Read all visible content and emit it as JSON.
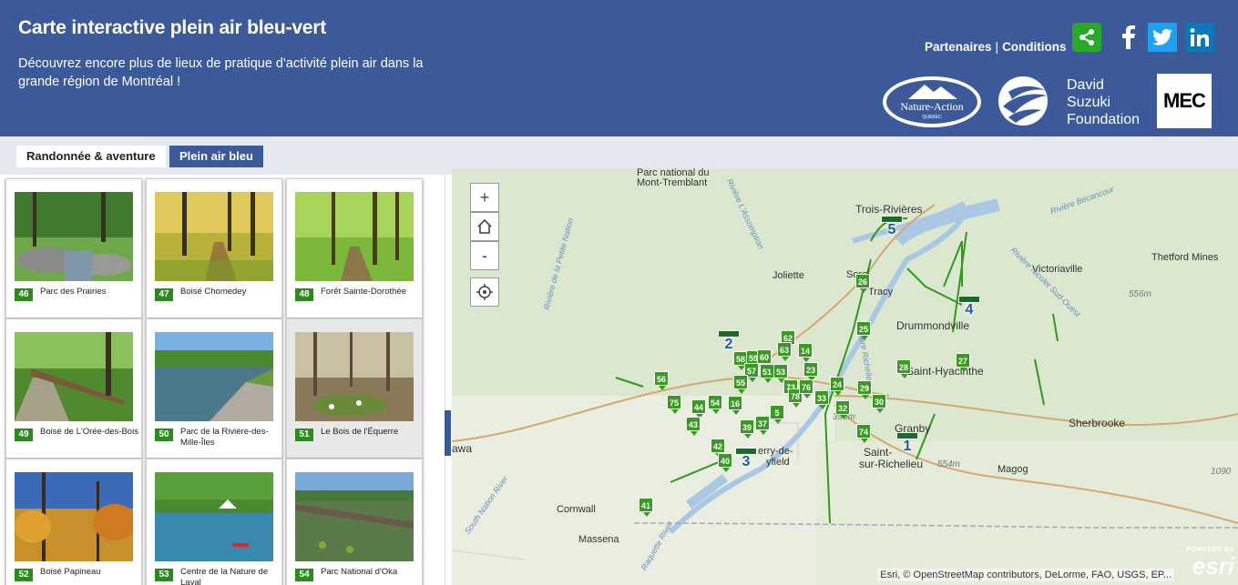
{
  "header": {
    "title": "Carte interactive plein air bleu-vert",
    "subtitle": "Découvrez encore plus de lieux de pratique d'activité plein air dans la grande région de Montréal !",
    "link_partners": "Partenaires",
    "separator": "|",
    "link_conditions": "Conditions",
    "logo_nature_action": "Nature-Action Québec",
    "logo_suzuki_lines": [
      "David",
      "Suzuki",
      "Foundation"
    ],
    "logo_mec": "MEC",
    "colors": {
      "header_bg": "#3c5a9a",
      "share_green": "#29a829",
      "twitter": "#1da1f2",
      "linkedin": "#0a78b7"
    }
  },
  "tabs": [
    {
      "label": "Randonnée & aventure",
      "active": true
    },
    {
      "label": "Plein air bleu",
      "active": false
    }
  ],
  "cards": [
    {
      "num": "46",
      "name": "Parc des Prairies"
    },
    {
      "num": "47",
      "name": "Boisé Chomedey"
    },
    {
      "num": "48",
      "name": "Forêt Sainte-Dorothée"
    },
    {
      "num": "49",
      "name": "Boisé de L'Orée-des-Bois"
    },
    {
      "num": "50",
      "name": "Parc de la Rivière-des-Mille-Îles"
    },
    {
      "num": "51",
      "name": "Le Bois de l'Équerre"
    },
    {
      "num": "52",
      "name": "Boisé Papineau"
    },
    {
      "num": "53",
      "name": "Centre de la Nature de Laval"
    },
    {
      "num": "54",
      "name": "Parc National d'Oka"
    }
  ],
  "map": {
    "zoom_in": "+",
    "zoom_out": "-",
    "labels": {
      "mont_tremblant_1": "Parc national du",
      "mont_tremblant_2": "Mont-Tremblant",
      "trois_rivieres": "Trois-Rivières",
      "joliette": "Joliette",
      "sorel": "Sorel",
      "tracy": "Tracy",
      "victoriaville": "Victoriaville",
      "thetford": "Thetford Mines",
      "drummondville": "Drummondville",
      "st_hyacinthe": "Saint-Hyacinthe",
      "granby": "Granby",
      "sherbrooke": "Sherbrooke",
      "st_jean": "Saint-",
      "st_jean_2": "sur-Richelieu",
      "valleyfield_1": "erry-de-",
      "valleyfield_2": "yfield",
      "magog": "Magog",
      "cornwall": "Cornwall",
      "massena": "Massena",
      "ottawa": "awa",
      "alt_556": "556m",
      "alt_554": "554m",
      "alt_393": "393m",
      "alt_1090": "1090",
      "river_assomption": "Rivière L'Assomption",
      "river_petite_nation": "Rivière de la Petite Nation",
      "river_bécancour": "Rivière Bécancour",
      "river_nicolet": "Rivière Nicolet Sud-Ouest",
      "river_richelieu": "Rivière Richelieu",
      "river_south_nation": "South Nation River",
      "river_raquette": "Raquette River"
    },
    "markers": [
      "62",
      "63",
      "14",
      "26",
      "25",
      "28",
      "27",
      "58",
      "59",
      "60",
      "57",
      "51",
      "53",
      "55",
      "23",
      "56",
      "54",
      "44",
      "75",
      "16",
      "73",
      "78",
      "76",
      "33",
      "29",
      "24",
      "30",
      "32",
      "43",
      "39",
      "37",
      "5",
      "74",
      "42",
      "40",
      "41"
    ],
    "routes": [
      "5",
      "4",
      "2",
      "3",
      "1"
    ],
    "attribution": "Esri, © OpenStreetMap contributors, DeLorme, FAO, USGS, EP...",
    "esri_powered": "POWERED BY",
    "esri_logo": "esri"
  }
}
